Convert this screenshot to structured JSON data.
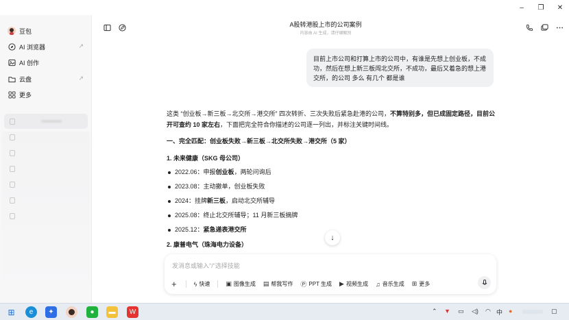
{
  "window": {
    "minimize": "–",
    "maximize": "❐",
    "close": "✕"
  },
  "sidebar": {
    "items": [
      {
        "label": "豆包",
        "icon": "avatar-icon"
      },
      {
        "label": "AI 浏览器",
        "icon": "compass-icon",
        "arrow": "↗"
      },
      {
        "label": "AI 创作",
        "icon": "image-icon"
      },
      {
        "label": "云盘",
        "icon": "folder-icon",
        "arrow": "↗"
      },
      {
        "label": "更多",
        "icon": "grid-icon"
      }
    ]
  },
  "header": {
    "title": "A股转港股上市的公司案例",
    "subtitle": "内容由 AI 生成，请仔细甄别"
  },
  "user_message": "目前上市公司和打算上市的公司中，有谁是先想上创业板，不成功，然后在想上新三板闯北交所，不成功，最后又着急的想上港交所，的公司 多么 有几个  都是谁",
  "answer": {
    "intro_plain_1": "这类 “创业板→新三板→北交所→港交所” 四次转折、三次失败后紧急赴港的公司，",
    "intro_bold_1": "不算特别多，但已成固定路径，目前公开可查约 10 家左右",
    "intro_plain_2": "，下面把完全符合你描述的公司逐一列出，并标注关键时间线。",
    "section1": "一、完全匹配：创业板失败→新三板→北交所失败→港交所（5 家）",
    "company1": "1. 未来健康（SKG 母公司）",
    "timeline1": [
      {
        "plain": "2022.06：申报",
        "bold": "创业板",
        "rest": "，两轮问询后"
      },
      {
        "plain": "2023.08：主动撤单，创业板失败",
        "bold": "",
        "rest": ""
      },
      {
        "plain": "2024：挂牌",
        "bold": "新三板",
        "rest": "，启动北交所辅导"
      },
      {
        "plain": "2025.08：终止北交所辅导；11 月新三板摘牌",
        "bold": "",
        "rest": ""
      },
      {
        "plain": "2025.12：",
        "bold": "紧急递表港交所",
        "rest": ""
      }
    ],
    "company2": "2. 康普电气（珠海电力设备）"
  },
  "input": {
    "placeholder": "发消息或输入\"/\"选择技能",
    "tools": [
      {
        "label": "快速",
        "icon": "lightning-icon"
      },
      {
        "label": "图像生成",
        "icon": "image-gen-icon"
      },
      {
        "label": "帮我写作",
        "icon": "write-icon"
      },
      {
        "label": "PPT 生成",
        "icon": "ppt-icon"
      },
      {
        "label": "视频生成",
        "icon": "video-icon"
      },
      {
        "label": "音乐生成",
        "icon": "music-icon"
      },
      {
        "label": "更多",
        "icon": "grid-icon"
      }
    ]
  },
  "colors": {
    "accent": "#1f1f1f",
    "bubble_bg": "#f0f1f3",
    "sidebar_bg": "#f7f7f8",
    "taskbar_bg": "#e7ecf2"
  }
}
